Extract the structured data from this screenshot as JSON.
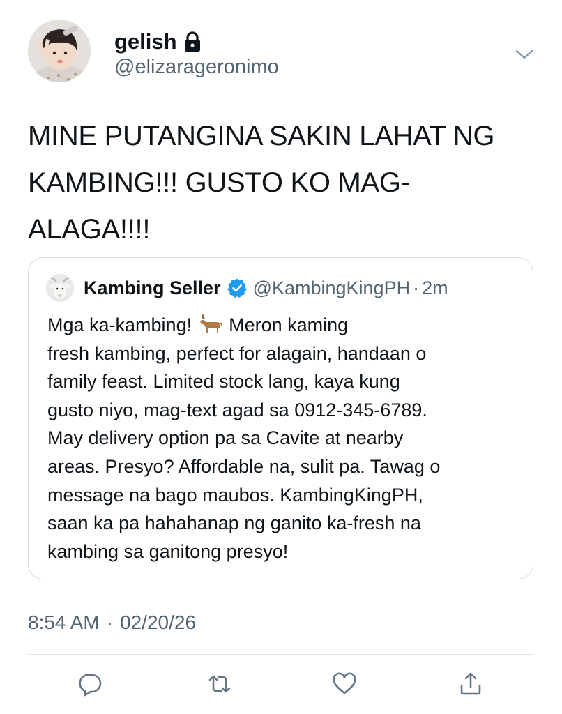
{
  "header": {
    "display_name": "gelish",
    "handle": "@elizarageronimo",
    "icons": {
      "lock": "lock-icon",
      "menu": "chevron-down-icon"
    }
  },
  "tweet": {
    "text": "MINE PUTANGINA SAKIN LAHAT NG KAMBING!!! GUSTO KO MAG-ALAGA!!!!",
    "lines": [
      "MINE PUTANGINA SAKIN LAHAT NG",
      "KAMBING!!! GUSTO KO MAG-",
      "ALAGA!!!!"
    ]
  },
  "quote": {
    "name": "Kambing Seller",
    "handle": "@KambingKingPH",
    "separator": "·",
    "time": "2m",
    "verified_icon": "verified-badge-icon",
    "text": {
      "first_line_before_emoji": "Mga ka-kambing!",
      "emoji": "goat-emoji",
      "first_line_after_emoji": "Meron kaming",
      "rest_lines": [
        "fresh kambing, perfect for alagain, handaan o",
        "family feast. Limited stock lang, kaya kung",
        "gusto niyo, mag-text agad sa 0912-345-6789.",
        "May delivery option pa sa Cavite at nearby",
        "areas. Presyo? Affordable na, sulit pa. Tawag o",
        "message na bago maubos. KambingKingPH,",
        "saan ka pa hahahanap ng ganito ka-fresh na",
        "kambing sa ganitong presyo!"
      ]
    }
  },
  "meta": {
    "time": "8:54 AM",
    "separator": "·",
    "date": "02/20/26"
  },
  "actions": {
    "icons": [
      "reply-icon",
      "retweet-icon",
      "like-icon",
      "share-icon"
    ]
  },
  "colors": {
    "text": "#0f1419",
    "secondary": "#536471",
    "verified": "#1d9bf0",
    "border": "#d5dbe0"
  }
}
